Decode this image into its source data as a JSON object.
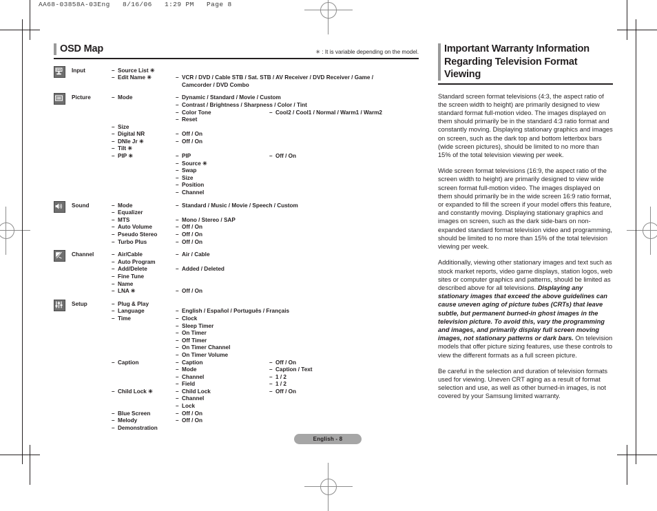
{
  "print_header": "AA68-03858A-03Eng   8/16/06   1:29 PM   Page 8",
  "footer": {
    "page_label": "English - 8"
  },
  "left_column": {
    "title": "OSD Map",
    "model_note": "✳ : It is variable depending on the model.",
    "groups": [
      {
        "icon": "input-icon",
        "name": "Input",
        "lines": [
          {
            "c1": "Source List ✳",
            "c2": "",
            "c3": ""
          },
          {
            "c1": "Edit Name ✳",
            "c2": "VCR / DVD / Cable STB / Sat. STB / AV Receiver / DVD Receiver / Game /",
            "c3": "",
            "wide": true
          },
          {
            "c1": "",
            "c2": "Camcorder / DVD Combo",
            "c3": "",
            "wide": true,
            "cont": true
          }
        ]
      },
      {
        "icon": "picture-icon",
        "name": "Picture",
        "lines": [
          {
            "c1": "Mode",
            "c2": "Dynamic / Standard / Movie / Custom",
            "c3": "",
            "wide": true
          },
          {
            "c1": "",
            "c2": "Contrast / Brightness / Sharpness / Color / Tint",
            "c3": "",
            "wide": true
          },
          {
            "c1": "",
            "c2": "Color Tone",
            "c3": "Cool2 / Cool1 / Normal / Warm1 / Warm2"
          },
          {
            "c1": "",
            "c2": "Reset",
            "c3": ""
          },
          {
            "c1": "Size",
            "c2": "",
            "c3": ""
          },
          {
            "c1": "Digital NR",
            "c2": "Off / On",
            "c3": ""
          },
          {
            "c1": "DNIe Jr ✳",
            "c2": "Off / On",
            "c3": ""
          },
          {
            "c1": "Tilt ✳",
            "c2": "",
            "c3": ""
          },
          {
            "c1": "PIP  ✳",
            "c2": "PIP",
            "c3": "Off / On"
          },
          {
            "c1": "",
            "c2": "Source ✳",
            "c3": ""
          },
          {
            "c1": "",
            "c2": "Swap",
            "c3": ""
          },
          {
            "c1": "",
            "c2": "Size",
            "c3": ""
          },
          {
            "c1": "",
            "c2": "Position",
            "c3": ""
          },
          {
            "c1": "",
            "c2": "Channel",
            "c3": ""
          }
        ]
      },
      {
        "icon": "sound-icon",
        "name": "Sound",
        "lines": [
          {
            "c1": "Mode",
            "c2": "Standard / Music / Movie / Speech / Custom",
            "c3": "",
            "wide": true
          },
          {
            "c1": "Equalizer",
            "c2": "",
            "c3": ""
          },
          {
            "c1": "MTS",
            "c2": "Mono / Stereo / SAP",
            "c3": "",
            "wide": true
          },
          {
            "c1": "Auto Volume",
            "c2": "Off / On",
            "c3": ""
          },
          {
            "c1": "Pseudo Stereo",
            "c2": "Off / On",
            "c3": ""
          },
          {
            "c1": "Turbo Plus",
            "c2": "Off / On",
            "c3": ""
          }
        ]
      },
      {
        "icon": "channel-icon",
        "name": "Channel",
        "lines": [
          {
            "c1": "Air/Cable",
            "c2": "Air / Cable",
            "c3": ""
          },
          {
            "c1": "Auto Program",
            "c2": "",
            "c3": ""
          },
          {
            "c1": "Add/Delete",
            "c2": "Added / Deleted",
            "c3": "",
            "wide": true
          },
          {
            "c1": "Fine Tune",
            "c2": "",
            "c3": ""
          },
          {
            "c1": "Name",
            "c2": "",
            "c3": ""
          },
          {
            "c1": "LNA ✳",
            "c2": "Off / On",
            "c3": ""
          }
        ]
      },
      {
        "icon": "setup-icon",
        "name": "Setup",
        "lines": [
          {
            "c1": "Plug & Play",
            "c2": "",
            "c3": ""
          },
          {
            "c1": "Language",
            "c2": "English / Español / Português / Français",
            "c3": "",
            "wide": true
          },
          {
            "c1": "Time",
            "c2": "Clock",
            "c3": ""
          },
          {
            "c1": "",
            "c2": "Sleep Timer",
            "c3": ""
          },
          {
            "c1": "",
            "c2": "On Timer",
            "c3": ""
          },
          {
            "c1": "",
            "c2": "Off Timer",
            "c3": ""
          },
          {
            "c1": "",
            "c2": "On Timer Channel",
            "c3": ""
          },
          {
            "c1": "",
            "c2": "On Timer Volume",
            "c3": ""
          },
          {
            "c1": "Caption",
            "c2": "Caption",
            "c3": "Off / On"
          },
          {
            "c1": "",
            "c2": "Mode",
            "c3": "Caption / Text"
          },
          {
            "c1": "",
            "c2": "Channel",
            "c3": "1 / 2"
          },
          {
            "c1": "",
            "c2": "Field",
            "c3": "1 / 2"
          },
          {
            "c1": "Child Lock ✳",
            "c2": "Child Lock",
            "c3": "Off / On"
          },
          {
            "c1": "",
            "c2": "Channel",
            "c3": ""
          },
          {
            "c1": "",
            "c2": "Lock",
            "c3": ""
          },
          {
            "c1": "Blue Screen",
            "c2": "Off / On",
            "c3": ""
          },
          {
            "c1": "Melody",
            "c2": "Off / On",
            "c3": ""
          },
          {
            "c1": "Demonstration",
            "c2": "",
            "c3": ""
          }
        ]
      }
    ]
  },
  "right_column": {
    "title_line1": "Important Warranty Information",
    "title_line2": "Regarding Television Format Viewing",
    "paragraphs": [
      {
        "plain": "Standard screen format televisions (4:3, the aspect ratio of the screen width to height) are primarily designed to view standard format full-motion video. The images displayed on them should primarily be in the standard 4:3 ratio format and constantly moving. Displaying stationary graphics and images on screen, such as the dark top and bottom letterbox bars (wide screen pictures), should be limited to no more than 15% of the total television viewing per week."
      },
      {
        "plain": "Wide screen format televisions (16:9, the aspect ratio of the screen width to height) are primarily designed to view wide screen format full-motion video. The images displayed on them should primarily be in the wide screen 16:9 ratio format, or expanded to fill the screen if your model offers this feature, and constantly moving. Displaying stationary graphics and images on screen, such as the dark side-bars on non-expanded standard format television video and programming, should be limited to no more than 15% of the total television viewing per week."
      },
      {
        "lead": "Additionally, viewing other stationary images and text such as stock market reports, video game displays, station logos, web sites or computer graphics and patterns, should be limited as described above for all televisions. ",
        "emph": "Displaying any stationary images that exceed the above guidelines can cause uneven aging of picture tubes (CRTs) that leave subtle, but permanent burned-in ghost images in the television picture. To avoid this, vary the programming and images, and primarily display full screen moving images, not stationary patterns or dark bars.",
        "tail": " On television models that offer picture sizing features, use these controls to view the different formats as a full screen picture."
      },
      {
        "plain": "Be careful in the selection and duration of television formats used for viewing. Uneven CRT aging as a result of format selection and use, as well as other burned-in images, is not covered by your Samsung limited warranty."
      }
    ]
  }
}
